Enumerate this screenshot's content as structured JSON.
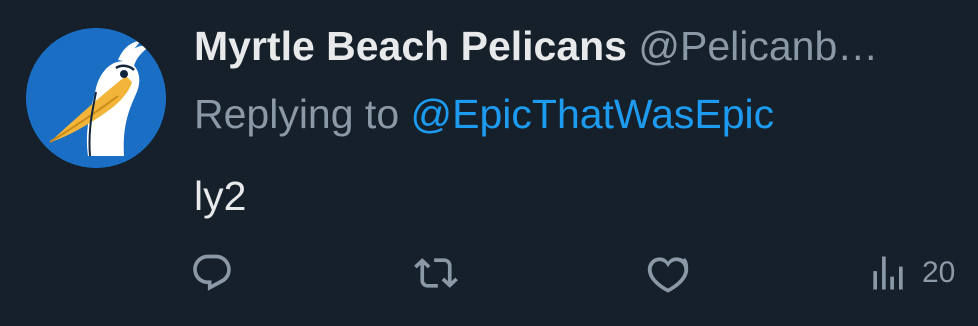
{
  "tweet": {
    "display_name": "Myrtle Beach Pelicans",
    "handle": "@Pelicanb…",
    "reply_prefix": "Replying to ",
    "reply_target": "@EpicThatWasEpic",
    "text": "ly2"
  },
  "actions": {
    "reply_icon": "speech-bubble-icon",
    "retweet_icon": "retweet-icon",
    "like_icon": "heart-icon",
    "views_icon": "bar-chart-icon",
    "views_count": "20"
  },
  "colors": {
    "background": "#15202b",
    "primary_text": "#e7e9ea",
    "secondary_text": "#8b98a5",
    "link": "#1d9bf0",
    "avatar_background": "#1a6fc4"
  }
}
